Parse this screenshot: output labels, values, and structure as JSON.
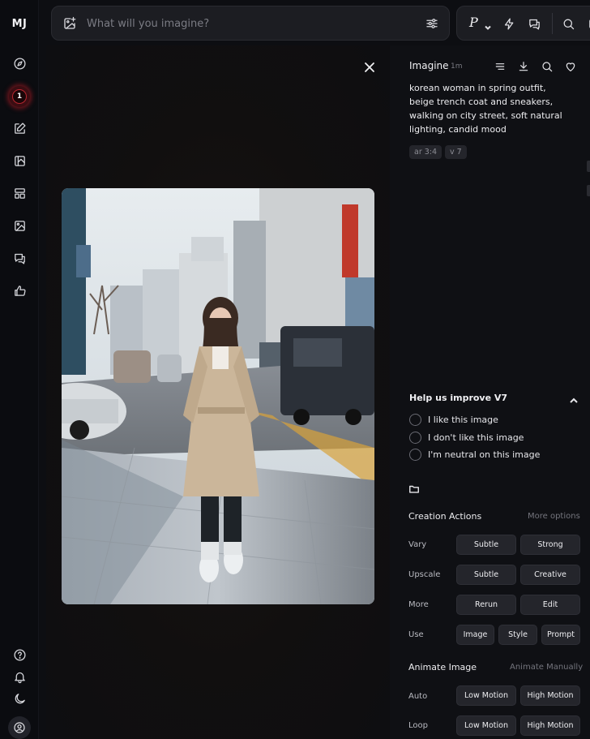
{
  "app": {
    "logo": "MJ"
  },
  "sidebar": {
    "badge_count": "1",
    "items": [
      {
        "name": "explore",
        "icon": "compass-icon"
      },
      {
        "name": "create",
        "icon": "edit-icon"
      },
      {
        "name": "edit",
        "icon": "image-edit-icon"
      },
      {
        "name": "organize",
        "icon": "layout-icon"
      },
      {
        "name": "personalize",
        "icon": "image-icon"
      },
      {
        "name": "chat",
        "icon": "chat-icon"
      },
      {
        "name": "rank",
        "icon": "thumbs-up-icon"
      }
    ],
    "bottom": [
      "help-icon",
      "bell-icon",
      "moon-icon",
      "account-icon"
    ]
  },
  "search": {
    "placeholder": "What will you imagine?"
  },
  "top_tools": {
    "profile_letter": "P"
  },
  "detail": {
    "title": "Imagine",
    "time": "1m",
    "prompt": "korean woman in spring outfit, beige trench coat and sneakers, walking on city street, soft natural lighting, candid mood",
    "params": [
      "ar 3:4",
      "v 7"
    ]
  },
  "feedback": {
    "title": "Help us improve V7",
    "options": [
      "I like this image",
      "I don't like this image",
      "I'm neutral on this image"
    ]
  },
  "creation_actions": {
    "title": "Creation Actions",
    "more": "More options",
    "rows": [
      {
        "label": "Vary",
        "buttons": [
          "Subtle",
          "Strong"
        ]
      },
      {
        "label": "Upscale",
        "buttons": [
          "Subtle",
          "Creative"
        ]
      },
      {
        "label": "More",
        "buttons": [
          "Rerun",
          "Edit"
        ]
      },
      {
        "label": "Use",
        "buttons": [
          "Image",
          "Style",
          "Prompt"
        ]
      }
    ]
  },
  "animate": {
    "title": "Animate Image",
    "manual": "Animate Manually",
    "rows": [
      {
        "label": "Auto",
        "buttons": [
          "Low Motion",
          "High Motion"
        ]
      },
      {
        "label": "Loop",
        "buttons": [
          "Low Motion",
          "High Motion"
        ]
      }
    ]
  },
  "colors": {
    "background": "#0d0e12",
    "panel": "#0f1014",
    "button": "#24252b",
    "badge": "#b8262f"
  }
}
